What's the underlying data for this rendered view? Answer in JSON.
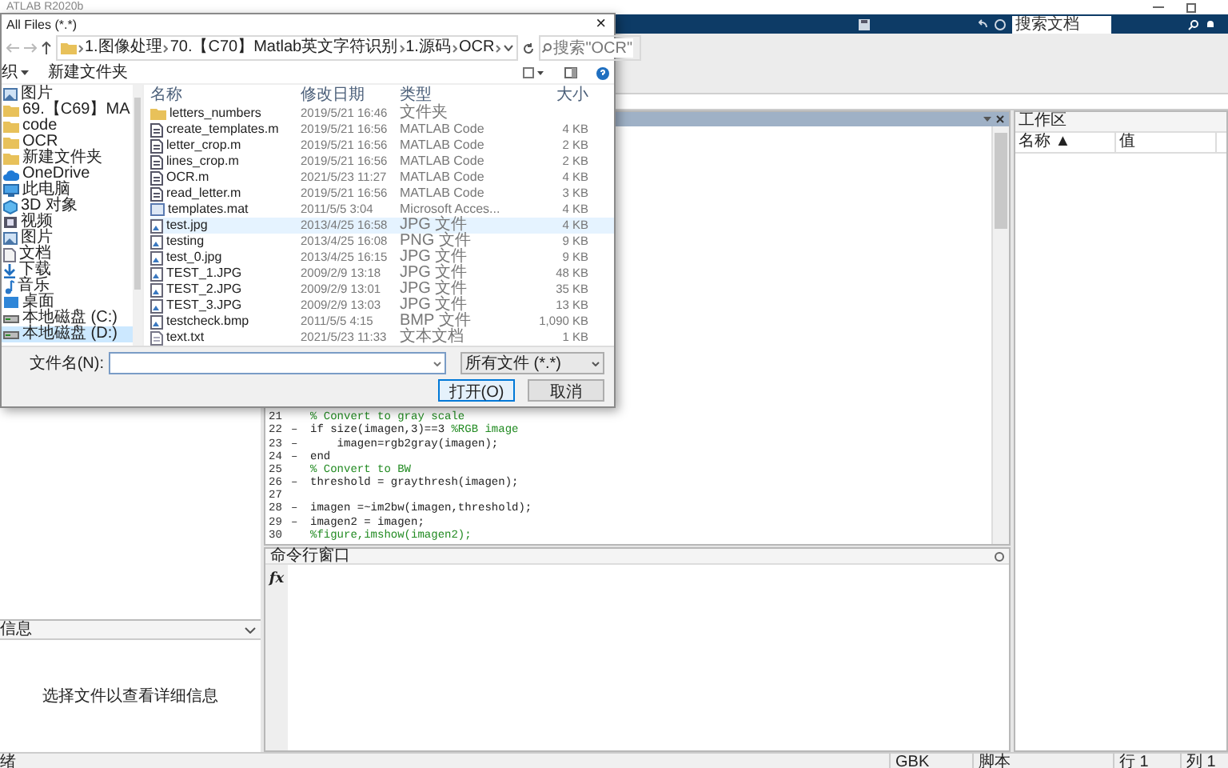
{
  "window": {
    "title": "ATLAB R2020b"
  },
  "toolbar": {
    "search_placeholder": "搜索文档"
  },
  "editor": {
    "lines": [
      {
        "number": "21",
        "comment": "% Convert to gray scale"
      },
      {
        "number": "22",
        "marker": "–",
        "code": "if size(imagen,3)==3 ",
        "comment": "%RGB image"
      },
      {
        "number": "23",
        "marker": "–",
        "code": "    imagen=rgb2gray(imagen);"
      },
      {
        "number": "24",
        "marker": "–",
        "code": "end"
      },
      {
        "number": "25",
        "comment": "% Convert to BW"
      },
      {
        "number": "26",
        "marker": "–",
        "code": "threshold = graythresh(imagen);"
      },
      {
        "number": "27"
      },
      {
        "number": "28",
        "marker": "–",
        "code": "imagen =~im2bw(imagen,threshold);"
      },
      {
        "number": "29",
        "marker": "–",
        "code": "imagen2 = imagen;"
      },
      {
        "number": "30",
        "comment": "%figure,imshow(imagen2);"
      }
    ]
  },
  "command_window": {
    "title": "命令行窗口",
    "prompt": "fx"
  },
  "details_panel": {
    "title": "信息",
    "message": "选择文件以查看详细信息"
  },
  "workspace": {
    "title": "工作区",
    "columns": [
      "名称 ▲",
      "值"
    ]
  },
  "status_bar": {
    "state": "绪",
    "encoding": "GBK",
    "file_type": "脚本",
    "line": "行 1",
    "column": "列 1"
  },
  "dialog": {
    "title": "All Files (*.*)",
    "close": "×",
    "breadcrumb": [
      "1.图像处理",
      "70.【C70】Matlab英文字符识别",
      "1.源码",
      "OCR"
    ],
    "search": {
      "placeholder": "搜索\"OCR\""
    },
    "toolbar": [
      "织",
      "新建文件夹"
    ],
    "nav": [
      {
        "kind": "picture",
        "label": "图片",
        "selected": false
      },
      {
        "kind": "folder",
        "label": "69.【C69】MA",
        "selected": false
      },
      {
        "kind": "folder",
        "label": "code",
        "selected": false
      },
      {
        "kind": "folder",
        "label": "OCR",
        "selected": false
      },
      {
        "kind": "folder",
        "label": "新建文件夹",
        "selected": false
      },
      {
        "kind": "cloud",
        "label": "OneDrive",
        "selected": false
      },
      {
        "kind": "computer",
        "label": "此电脑",
        "selected": false
      },
      {
        "kind": "cube",
        "label": "3D 对象",
        "selected": false
      },
      {
        "kind": "video",
        "label": "视频",
        "selected": false
      },
      {
        "kind": "picture",
        "label": "图片",
        "selected": false
      },
      {
        "kind": "document",
        "label": "文档",
        "selected": false
      },
      {
        "kind": "download",
        "label": "下载",
        "selected": false
      },
      {
        "kind": "music",
        "label": "音乐",
        "selected": false
      },
      {
        "kind": "desktop",
        "label": "桌面",
        "selected": false
      },
      {
        "kind": "drive",
        "label": "本地磁盘 (C:)",
        "selected": false
      },
      {
        "kind": "drive",
        "label": "本地磁盘 (D:)",
        "selected": true
      }
    ],
    "columns": [
      "名称",
      "修改日期",
      "类型",
      "大小"
    ],
    "files": [
      {
        "kind": "folder",
        "name": "letters_numbers",
        "date": "2019/5/21 16:46",
        "type": "文件夹",
        "hovered": false
      },
      {
        "kind": "script",
        "name": "create_templates.m",
        "date": "2019/5/21 16:56",
        "type": "MATLAB Code",
        "size": "4 KB",
        "hovered": false
      },
      {
        "kind": "script",
        "name": "letter_crop.m",
        "date": "2019/5/21 16:56",
        "type": "MATLAB Code",
        "size": "2 KB",
        "hovered": false
      },
      {
        "kind": "script",
        "name": "lines_crop.m",
        "date": "2019/5/21 16:56",
        "type": "MATLAB Code",
        "size": "2 KB",
        "hovered": false
      },
      {
        "kind": "script",
        "name": "OCR.m",
        "date": "2021/5/23 11:27",
        "type": "MATLAB Code",
        "size": "4 KB",
        "hovered": false
      },
      {
        "kind": "script",
        "name": "read_letter.m",
        "date": "2019/5/21 16:56",
        "type": "MATLAB Code",
        "size": "3 KB",
        "hovered": false
      },
      {
        "kind": "data",
        "name": "templates.mat",
        "date": "2011/5/5 3:04",
        "type": "Microsoft Acces...",
        "size": "4 KB",
        "hovered": false
      },
      {
        "kind": "image",
        "name": "test.jpg",
        "date": "2013/4/25 16:58",
        "type": "JPG 文件",
        "size": "4 KB",
        "hovered": true
      },
      {
        "kind": "image",
        "name": "testing",
        "date": "2013/4/25 16:08",
        "type": "PNG 文件",
        "size": "9 KB",
        "hovered": false
      },
      {
        "kind": "image",
        "name": "test_0.jpg",
        "date": "2013/4/25 16:15",
        "type": "JPG 文件",
        "size": "9 KB",
        "hovered": false
      },
      {
        "kind": "image",
        "name": "TEST_1.JPG",
        "date": "2009/2/9 13:18",
        "type": "JPG 文件",
        "size": "48 KB",
        "hovered": false
      },
      {
        "kind": "image",
        "name": "TEST_2.JPG",
        "date": "2009/2/9 13:01",
        "type": "JPG 文件",
        "size": "35 KB",
        "hovered": false
      },
      {
        "kind": "image",
        "name": "TEST_3.JPG",
        "date": "2009/2/9 13:03",
        "type": "JPG 文件",
        "size": "13 KB",
        "hovered": false
      },
      {
        "kind": "image",
        "name": "testcheck.bmp",
        "date": "2011/5/5 4:15",
        "type": "BMP 文件",
        "size": "1,090 KB",
        "hovered": false
      },
      {
        "kind": "text",
        "name": "text.txt",
        "date": "2021/5/23 11:33",
        "type": "文本文档",
        "size": "1 KB",
        "hovered": false
      }
    ],
    "filename_label": "文件名(N):",
    "filter": "所有文件 (*.*)",
    "buttons": [
      {
        "kind": "primary",
        "label": "打开(O)"
      },
      {
        "kind": "normal",
        "label": "取消"
      }
    ]
  }
}
